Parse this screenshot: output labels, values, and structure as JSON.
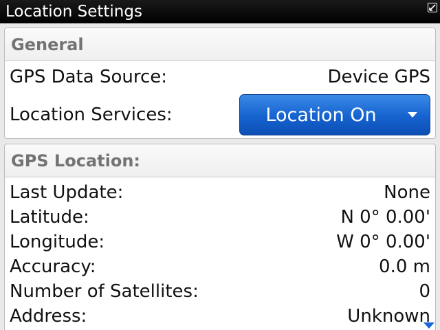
{
  "window": {
    "title": "Location Settings"
  },
  "general": {
    "header": "General",
    "gps_source_label": "GPS Data Source:",
    "gps_source_value": "Device GPS",
    "location_services_label": "Location Services:",
    "location_services_value": "Location On"
  },
  "gps_location": {
    "header": "GPS Location:",
    "rows": [
      {
        "label": "Last Update:",
        "value": "None"
      },
      {
        "label": "Latitude:",
        "value": "N 0° 0.00'"
      },
      {
        "label": "Longitude:",
        "value": "W 0° 0.00'"
      },
      {
        "label": "Accuracy:",
        "value": "0.0 m"
      },
      {
        "label": "Number of Satellites:",
        "value": "0"
      },
      {
        "label": "Address:",
        "value": "Unknown"
      }
    ]
  },
  "icons": {
    "resize": "resize-icon",
    "dropdown": "chevron-down-icon",
    "scroll": "scroll-down-icon"
  },
  "colors": {
    "accent": "#1562cf",
    "titlebar": "#000000",
    "section_header_text": "#737373"
  }
}
